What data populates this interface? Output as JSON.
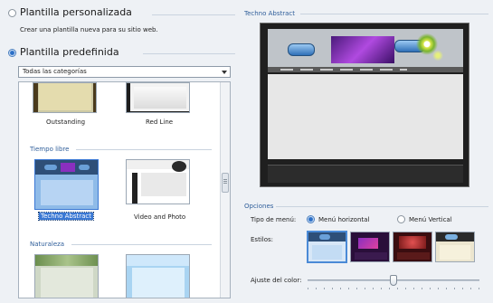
{
  "left": {
    "custom_label": "Plantilla personalizada",
    "custom_desc": "Crear una plantilla nueva para su sitio web.",
    "predefined_label": "Plantilla predefinida",
    "category_select": "Todas las categorías",
    "templates": {
      "outstanding": "Outstanding",
      "red_line": "Red Line",
      "tiempo_libre": "Tiempo libre",
      "techno_abstract": "Techno Abstract",
      "video_photo": "Video and Photo",
      "naturaleza": "Naturaleza"
    }
  },
  "right": {
    "preview_title": "Techno Abstract",
    "options_title": "Opciones",
    "menu_type_label": "Tipo de menú:",
    "menu_horizontal": "Menú horizontal",
    "menu_vertical": "Menú Vertical",
    "styles_label": "Estilos:",
    "color_label": "Ajuste del color:"
  },
  "colors": {
    "accent": "#2f5e9a",
    "selected_bg": "#3a78d4",
    "purple": "#8a2fbf"
  },
  "state": {
    "color_adjust": 0.5
  }
}
